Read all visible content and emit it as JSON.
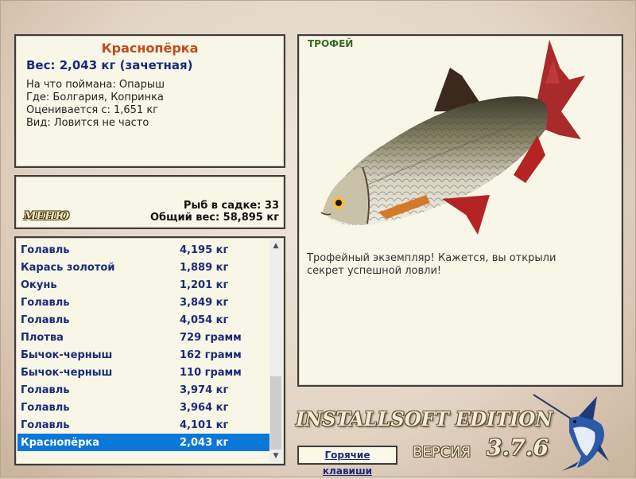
{
  "info": {
    "title": "Краснопёрка",
    "weight": "Вес: 2,043 кг (зачетная)",
    "lines": [
      "На что поймана: Опарыш",
      "Где: Болгария, Копринка",
      "Оценивается с: 1,651 кг",
      "Вид: Ловится не часто"
    ]
  },
  "menu": {
    "button_label": "МЕНЮ",
    "catch_count": "Рыб в садке: 33",
    "catch_weight": "Общий вес: 58,895 кг"
  },
  "catch_list": [
    {
      "name": "Голавль",
      "weight": "4,195 кг"
    },
    {
      "name": "Карась золотой",
      "weight": "1,889 кг"
    },
    {
      "name": "Окунь",
      "weight": "1,201 кг"
    },
    {
      "name": "Голавль",
      "weight": "3,849 кг"
    },
    {
      "name": "Голавль",
      "weight": "4,054 кг"
    },
    {
      "name": "Плотва",
      "weight": "729 грамм"
    },
    {
      "name": "Бычок-черныш",
      "weight": "162 грамм"
    },
    {
      "name": "Бычок-черныш",
      "weight": "110 грамм"
    },
    {
      "name": "Голавль",
      "weight": "3,974 кг"
    },
    {
      "name": "Голавль",
      "weight": "3,964 кг"
    },
    {
      "name": "Голавль",
      "weight": "4,101 кг"
    },
    {
      "name": "Краснопёрка",
      "weight": "2,043 кг"
    }
  ],
  "selected_index": 11,
  "trophy": {
    "label": "ТРОФЕЙ",
    "text": "Трофейный экземпляр! Кажется, вы открыли секрет успешной ловли!"
  },
  "footer": {
    "edition": "INSTALLSOFT EDITION",
    "version_label": "ВЕРСИЯ",
    "version_number": "3.7.6",
    "hotkeys_label": "Горячие клавиши"
  },
  "colors": {
    "title": "#c14a1c",
    "list_text": "#1c2a7a",
    "selection": "#0a78d8",
    "panel_bg": "#f8f6e6"
  },
  "icons": {
    "scroll_up": "triangle-up",
    "scroll_down": "triangle-down"
  }
}
